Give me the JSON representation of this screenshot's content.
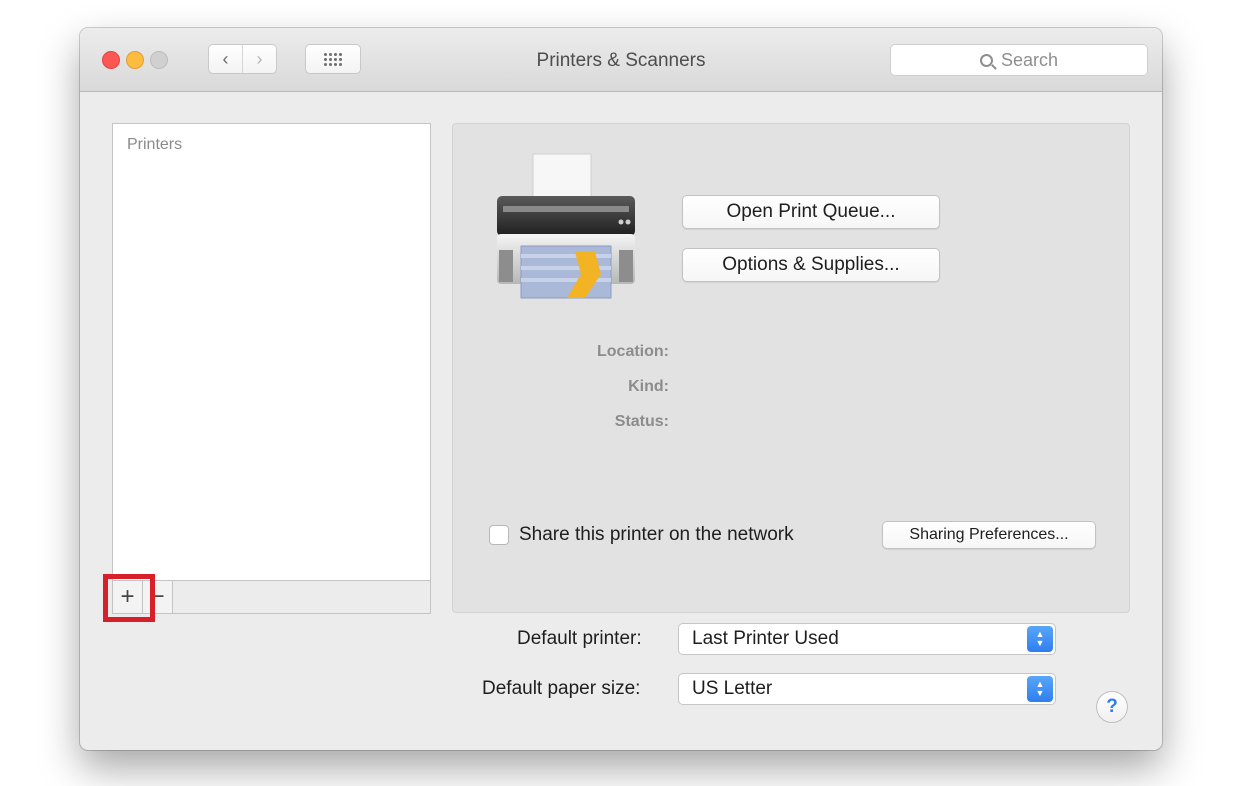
{
  "window": {
    "title": "Printers & Scanners"
  },
  "titlebar": {
    "back_label": "‹",
    "forward_label": "›"
  },
  "search": {
    "placeholder": "Search"
  },
  "sidebar": {
    "heading": "Printers",
    "add_label": "+",
    "remove_label": "−"
  },
  "detail": {
    "open_queue_label": "Open Print Queue...",
    "options_supplies_label": "Options & Supplies...",
    "location_label": "Location:",
    "kind_label": "Kind:",
    "status_label": "Status:",
    "share_label": "Share this printer on the network",
    "sharing_prefs_label": "Sharing Preferences..."
  },
  "defaults": {
    "printer_label": "Default printer:",
    "printer_value": "Last Printer Used",
    "paper_label": "Default paper size:",
    "paper_value": "US Letter"
  },
  "help": {
    "label": "?"
  },
  "colors": {
    "close": "#fc5753",
    "minimize": "#fdbc40",
    "zoom": "#d0d0d0",
    "accent": "#2f7ef0",
    "highlight": "#d8202a"
  },
  "icons": {
    "printer": "printer-icon",
    "search": "search-icon",
    "grid": "grid-icon"
  }
}
